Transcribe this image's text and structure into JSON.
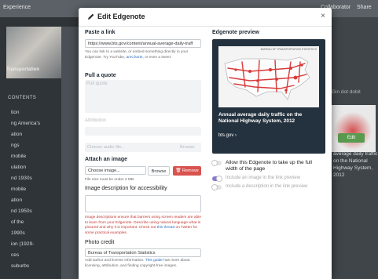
{
  "background": {
    "top_left": "Experience",
    "top_right_1": "Collaborator",
    "top_right_2": "Share",
    "caption": "Transportation",
    "contents_heading": "CONTENTS",
    "left_items": [
      "tion",
      "ng America's",
      "ation",
      "ngs",
      "mobile",
      "ulation",
      "nd 1930s",
      "mobile",
      "ation",
      "nd 1950s",
      "of the",
      "1990s",
      "ion (1929-",
      "ces",
      "suburbs"
    ],
    "right_label": "Gin dot dobit",
    "right_edit": "Edit",
    "right_caption": "average daily traffic on the National Highway System, 2012"
  },
  "modal": {
    "title": "Edit Edgenote",
    "close": "×",
    "paste_heading": "Paste a link",
    "link_value": "https://www.bts.gov/content/annual-average-daily-traff",
    "link_help": "You can link to a website, or embed something directly in your Edgenote. Try YouTube, ",
    "link_help_link": "amCharts",
    "link_help_end": ", or even a tweet.",
    "quote_heading": "Pull a quote",
    "quote_placeholder": "Pull quote",
    "attribution_placeholder": "Attribution",
    "audio_placeholder": "Choose audio file...",
    "audio_browse": "Browse",
    "image_heading": "Attach an image",
    "image_placeholder": "Choose image...",
    "image_browse": "Browse",
    "remove": "Remove",
    "size_note": "File size must be under 2 MB.",
    "desc_heading": "Image description for accessibility",
    "desc_error": "Image descriptions ensure that barriers using screen readers are able to learn from your Edgenote. Describe using natural language what is pictured and why it is important. Check out ",
    "desc_error_link": "this thread",
    "desc_error_end": " on Twitter for some practical examples.",
    "credit_heading": "Photo credit",
    "credit_value": "Bureau of Transportation Statistics",
    "credit_help": "Add author and license information. ",
    "credit_help_link": "This guide",
    "credit_help_end": " has more about licensing, attribution, and finding copyright-free images.",
    "preview_heading": "Edgenote preview",
    "preview_map_header": "BUREAU OF TRANSPORTATION STATISTICS",
    "preview_title": "Annual average daily traffic on the National Highway System, 2012",
    "preview_domain": "bts.gov ›",
    "toggles": [
      {
        "label": "Allow this Edgenote to take up the full width of the page",
        "on": false
      },
      {
        "label": "Include an image in the link preview",
        "on": true
      },
      {
        "label": "Include a description in the link preview",
        "on": false
      }
    ]
  },
  "colors": {
    "accent": "#2a6ebb",
    "danger": "#d9534f",
    "toggle_on": "#8c7ad1"
  }
}
